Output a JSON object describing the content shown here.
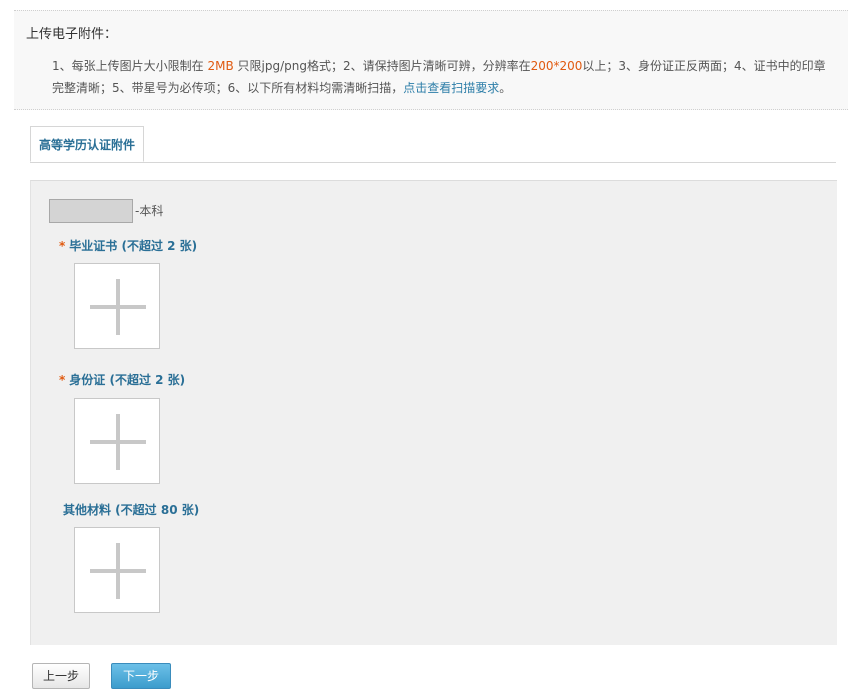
{
  "notice": {
    "title": "上传电子附件：",
    "line1_a": "1、每张上传图片大小限制在 ",
    "size_limit": "2MB",
    "line1_b": " 只限jpg/png格式；2、请保持图片清晰可辨，分辨率在",
    "resolution": "200*200",
    "line1_c": "以上；3、身份证正反两面；4、证书中的印章",
    "line2_a": "完整清晰；5、带星号为必传项；6、以下所有材料均需清晰扫描，",
    "link": "点击查看扫描要求",
    "line2_b": "。"
  },
  "tab": {
    "label": "高等学历认证附件"
  },
  "degree": {
    "suffix": "-本科"
  },
  "sections": [
    {
      "required": "*",
      "label": "毕业证书 (不超过 2 张)"
    },
    {
      "required": "*",
      "label": "身份证 (不超过 2 张)"
    },
    {
      "required": "",
      "label": "其他材料 (不超过 80 张)"
    }
  ],
  "buttons": {
    "prev": "上一步",
    "next": "下一步"
  },
  "icons": {
    "upload": "plus-icon"
  },
  "colors": {
    "accent": "#2a6f96",
    "highlight": "#e05a10",
    "primary_button": "#4aa8d8"
  }
}
